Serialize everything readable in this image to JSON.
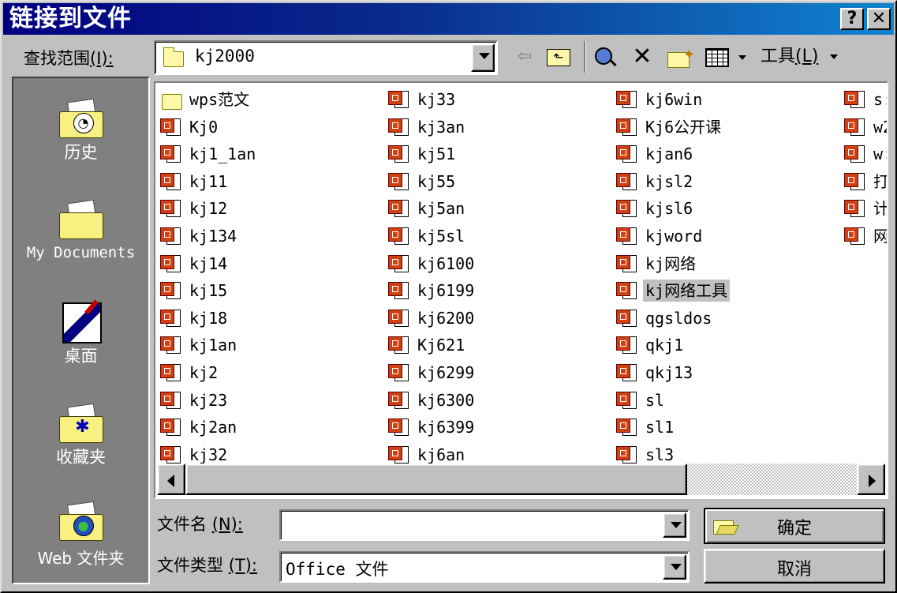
{
  "window": {
    "title": "链接到文件",
    "help_button": "?",
    "close_button": "✕"
  },
  "lookin": {
    "label": "查找范围",
    "hotkey": "(I):",
    "value": "kj2000"
  },
  "toolbar": {
    "tools_label": "工具",
    "tools_hotkey": "(L)",
    "icons": [
      "back-icon",
      "up-folder-icon",
      "search-web-icon",
      "delete-icon",
      "new-folder-icon",
      "views-icon",
      "tools-icon"
    ]
  },
  "places": [
    {
      "label": "历史",
      "icon": "history-icon"
    },
    {
      "label": "My Documents",
      "icon": "my-documents-icon"
    },
    {
      "label": "桌面",
      "icon": "desktop-icon"
    },
    {
      "label": "收藏夹",
      "icon": "favorites-icon"
    },
    {
      "label": "Web 文件夹",
      "icon": "web-folders-icon"
    }
  ],
  "files": {
    "col1": [
      "wps范文",
      "Kj0",
      "kj1_1an",
      "kj11",
      "kj12",
      "kj134",
      "kj14",
      "kj15",
      "kj18",
      "kj1an",
      "kj2",
      "kj23",
      "kj2an",
      "kj32"
    ],
    "col2": [
      "kj33",
      "kj3an",
      "kj51",
      "kj55",
      "kj5an",
      "kj5sl",
      "kj6100",
      "kj6199",
      "kj6200",
      "Kj621",
      "kj6299",
      "kj6300",
      "kj6399",
      "kj6an"
    ],
    "col3": [
      "kj6win",
      "Kj6公开课",
      "kjan6",
      "kjsl2",
      "kjsl6",
      "kjword",
      "kj网络",
      "kj网络工具",
      "qgsldos",
      "qkj1",
      "qkj13",
      "sl",
      "sl1",
      "sl3"
    ],
    "col4": [
      "s:",
      "w2",
      "w:",
      "打",
      "计",
      "网"
    ],
    "selected": "kj网络工具"
  },
  "filename": {
    "label": "文件名",
    "hotkey": "(N):",
    "value": ""
  },
  "filetype": {
    "label": "文件类型",
    "hotkey": "(T):",
    "value": "Office 文件"
  },
  "buttons": {
    "ok": "确定",
    "cancel": "取消"
  }
}
